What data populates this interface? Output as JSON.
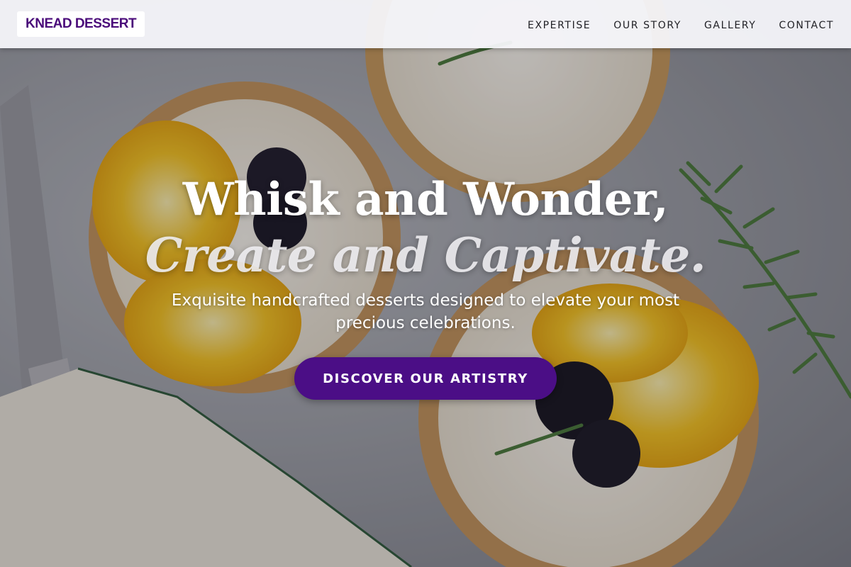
{
  "header": {
    "logo": "KNEAD DESSERT",
    "nav": [
      {
        "label": "EXPERTISE"
      },
      {
        "label": "OUR STORY"
      },
      {
        "label": "GALLERY"
      },
      {
        "label": "CONTACT"
      }
    ]
  },
  "hero": {
    "headline_line1": "Whisk and Wonder,",
    "headline_line2": "Create and Captivate.",
    "subtitle": "Exquisite handcrafted desserts designed to elevate your most precious celebrations.",
    "cta_label": "DISCOVER OUR ARTISTRY",
    "background_image": "dessert-tarts-photo"
  },
  "colors": {
    "brand_purple": "#4b0e86",
    "logo_text": "#4a0a7a",
    "header_bg": "#f6f6fa",
    "nav_text": "#1f1f24"
  }
}
